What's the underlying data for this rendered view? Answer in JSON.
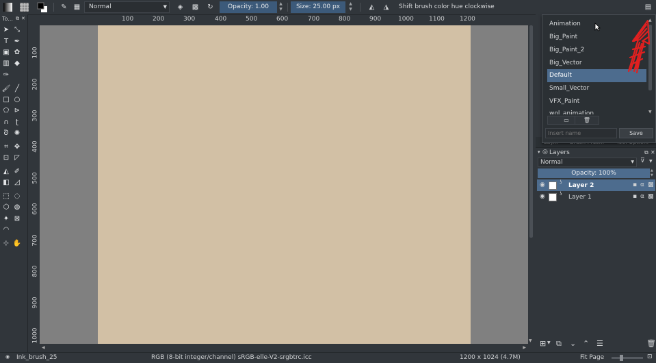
{
  "toolbar": {
    "blend_mode": "Normal",
    "opacity_label": "Opacity: 1.00",
    "size_label": "Size: 25.00 px",
    "hint": "Shift brush color hue clockwise"
  },
  "toolbox": {
    "title": "To..."
  },
  "ruler_top": [
    "100",
    "200",
    "300",
    "400",
    "500",
    "600",
    "700",
    "800",
    "900",
    "1000",
    "1100",
    "1200"
  ],
  "ruler_left": [
    "100",
    "200",
    "300",
    "400",
    "500",
    "600",
    "700",
    "800",
    "900",
    "1000"
  ],
  "presets": {
    "items": [
      "Animation",
      "Big_Paint",
      "Big_Paint_2",
      "Big_Vector",
      "Default",
      "Small_Vector",
      "VFX_Paint",
      "wol_animation"
    ],
    "selected": "Default",
    "name_placeholder": "Insert name",
    "save_label": "Save"
  },
  "docker_tabs": [
    "Lay...",
    "Brush Pres...",
    "Tool Optio..."
  ],
  "layers": {
    "title": "Layers",
    "blend_mode": "Normal",
    "opacity_label": "Opacity:  100%",
    "items": [
      {
        "name": "Layer 2",
        "selected": true
      },
      {
        "name": "Layer 1",
        "selected": false
      }
    ]
  },
  "status": {
    "brush": "Ink_brush_25",
    "color_info": "RGB (8-bit integer/channel)  sRGB-elle-V2-srgbtrc.icc",
    "size_info": "1200 x 1024 (4.7M)",
    "zoom": "Fit Page"
  },
  "colors": {
    "canvas": "#d2c0a5",
    "selection": "#4d6c8e",
    "arrow": "#e02020"
  }
}
